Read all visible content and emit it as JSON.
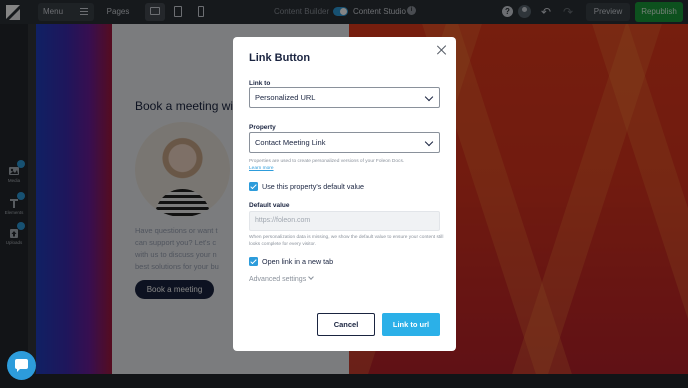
{
  "toolbar": {
    "menu_label": "Menu",
    "pages_label": "Pages",
    "devices": [
      {
        "icon": "desktop-icon"
      },
      {
        "icon": "tablet-icon"
      },
      {
        "icon": "mobile-icon"
      }
    ],
    "content_builder_label": "Content Builder",
    "content_studio_label": "Content Studio",
    "preview_label": "Preview",
    "publish_label": "Republish",
    "icons": {
      "help": "?",
      "undo": "↶",
      "redo": "↷"
    }
  },
  "sidebar": {
    "items": [
      {
        "label": "Media",
        "icon": "media-icon"
      },
      {
        "label": "Elements",
        "icon": "text-icon"
      },
      {
        "label": "Uploads",
        "icon": "upload-icon"
      }
    ]
  },
  "document": {
    "heading": "Book a meeting wi",
    "body_lines": [
      "Have questions or want t",
      "can support you? Let's c",
      "with us to discuss your n",
      "best solutions for your bu"
    ],
    "button_label": "Book a meeting"
  },
  "modal": {
    "title": "Link Button",
    "link_to": {
      "label": "Link to",
      "value": "Personalized URL"
    },
    "property": {
      "label": "Property",
      "value": "Contact Meeting Link",
      "help_text": "Properties are used to create personalized versions of your Foleon Docs.",
      "help_link": "Learn more"
    },
    "use_default": {
      "label": "Use this property's default value",
      "checked": true
    },
    "default_value": {
      "label": "Default value",
      "placeholder": "https://foleon.com",
      "help_text": "When personalization data is missing, we show the default value to ensure your content still looks complete for every visitor."
    },
    "open_new_tab": {
      "label": "Open link in a new tab",
      "checked": true
    },
    "advanced_label": "Advanced settings",
    "cancel_label": "Cancel",
    "confirm_label": "Link to url"
  },
  "colors": {
    "accent": "#2d9cdb",
    "primary_button": "#2bb0e8",
    "publish": "#1a9b3a",
    "dark_text": "#1a2440"
  }
}
